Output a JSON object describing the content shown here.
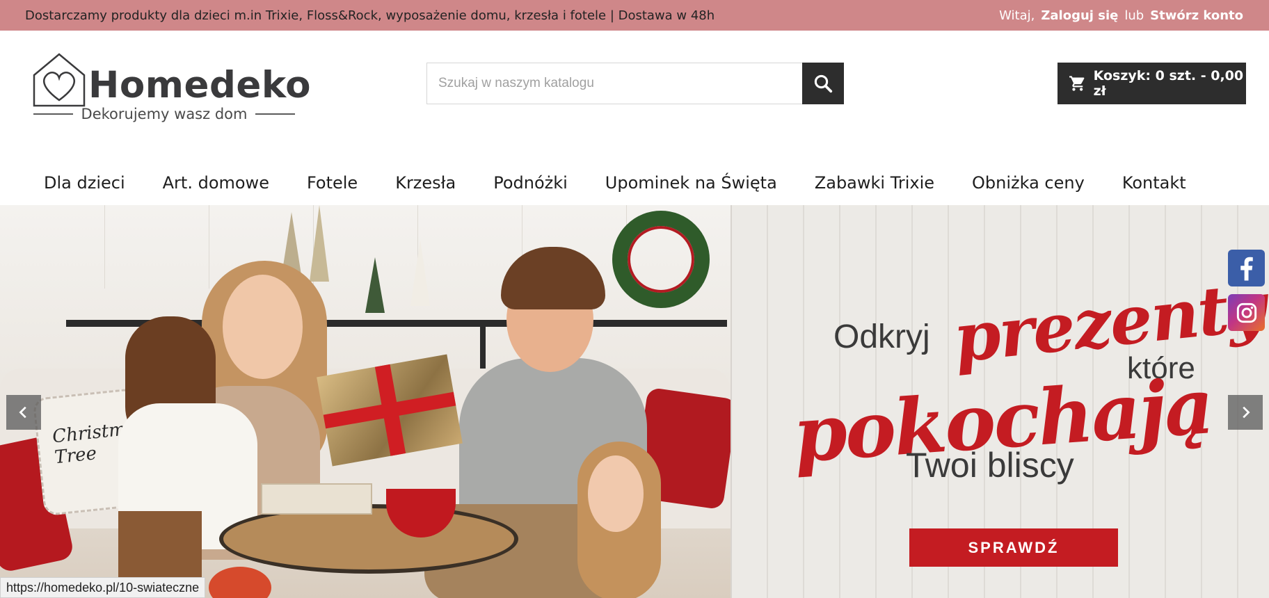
{
  "topbar": {
    "announcement": "Dostarczamy produkty dla dzieci m.in Trixie, Floss&Rock, wyposażenie domu, krzesła i fotele | Dostawa w 48h",
    "greeting": "Witaj,",
    "login": "Zaloguj się",
    "or": "lub",
    "register": "Stwórz konto"
  },
  "header": {
    "logo_name": "Homedeko",
    "logo_tagline": "Dekorujemy wasz dom",
    "search_placeholder": "Szukaj w naszym katalogu",
    "cart_label": "Koszyk: 0 szt. - 0,00 zł"
  },
  "nav": {
    "items": [
      "Dla dzieci",
      "Art. domowe",
      "Fotele",
      "Krzesła",
      "Podnóżki",
      "Upominek na Święta",
      "Zabawki Trixie",
      "Obniżka ceny",
      "Kontakt"
    ]
  },
  "slider": {
    "pillow_text": "Christmas Tree",
    "promo": {
      "line1": "Odkryj",
      "line2": "prezenty",
      "line3": "które",
      "line4": "pokochają",
      "line5": "Twoi bliscy",
      "cta": "SPRAWDŹ"
    }
  },
  "social": [
    "facebook-icon",
    "instagram-icon"
  ],
  "statusbar": {
    "url": "https://homedeko.pl/10-swiateczne"
  },
  "colors": {
    "topbar": "#cf8789",
    "dark": "#2d2d2d",
    "promo_red": "#c41c22",
    "facebook": "#3b5ea8"
  }
}
